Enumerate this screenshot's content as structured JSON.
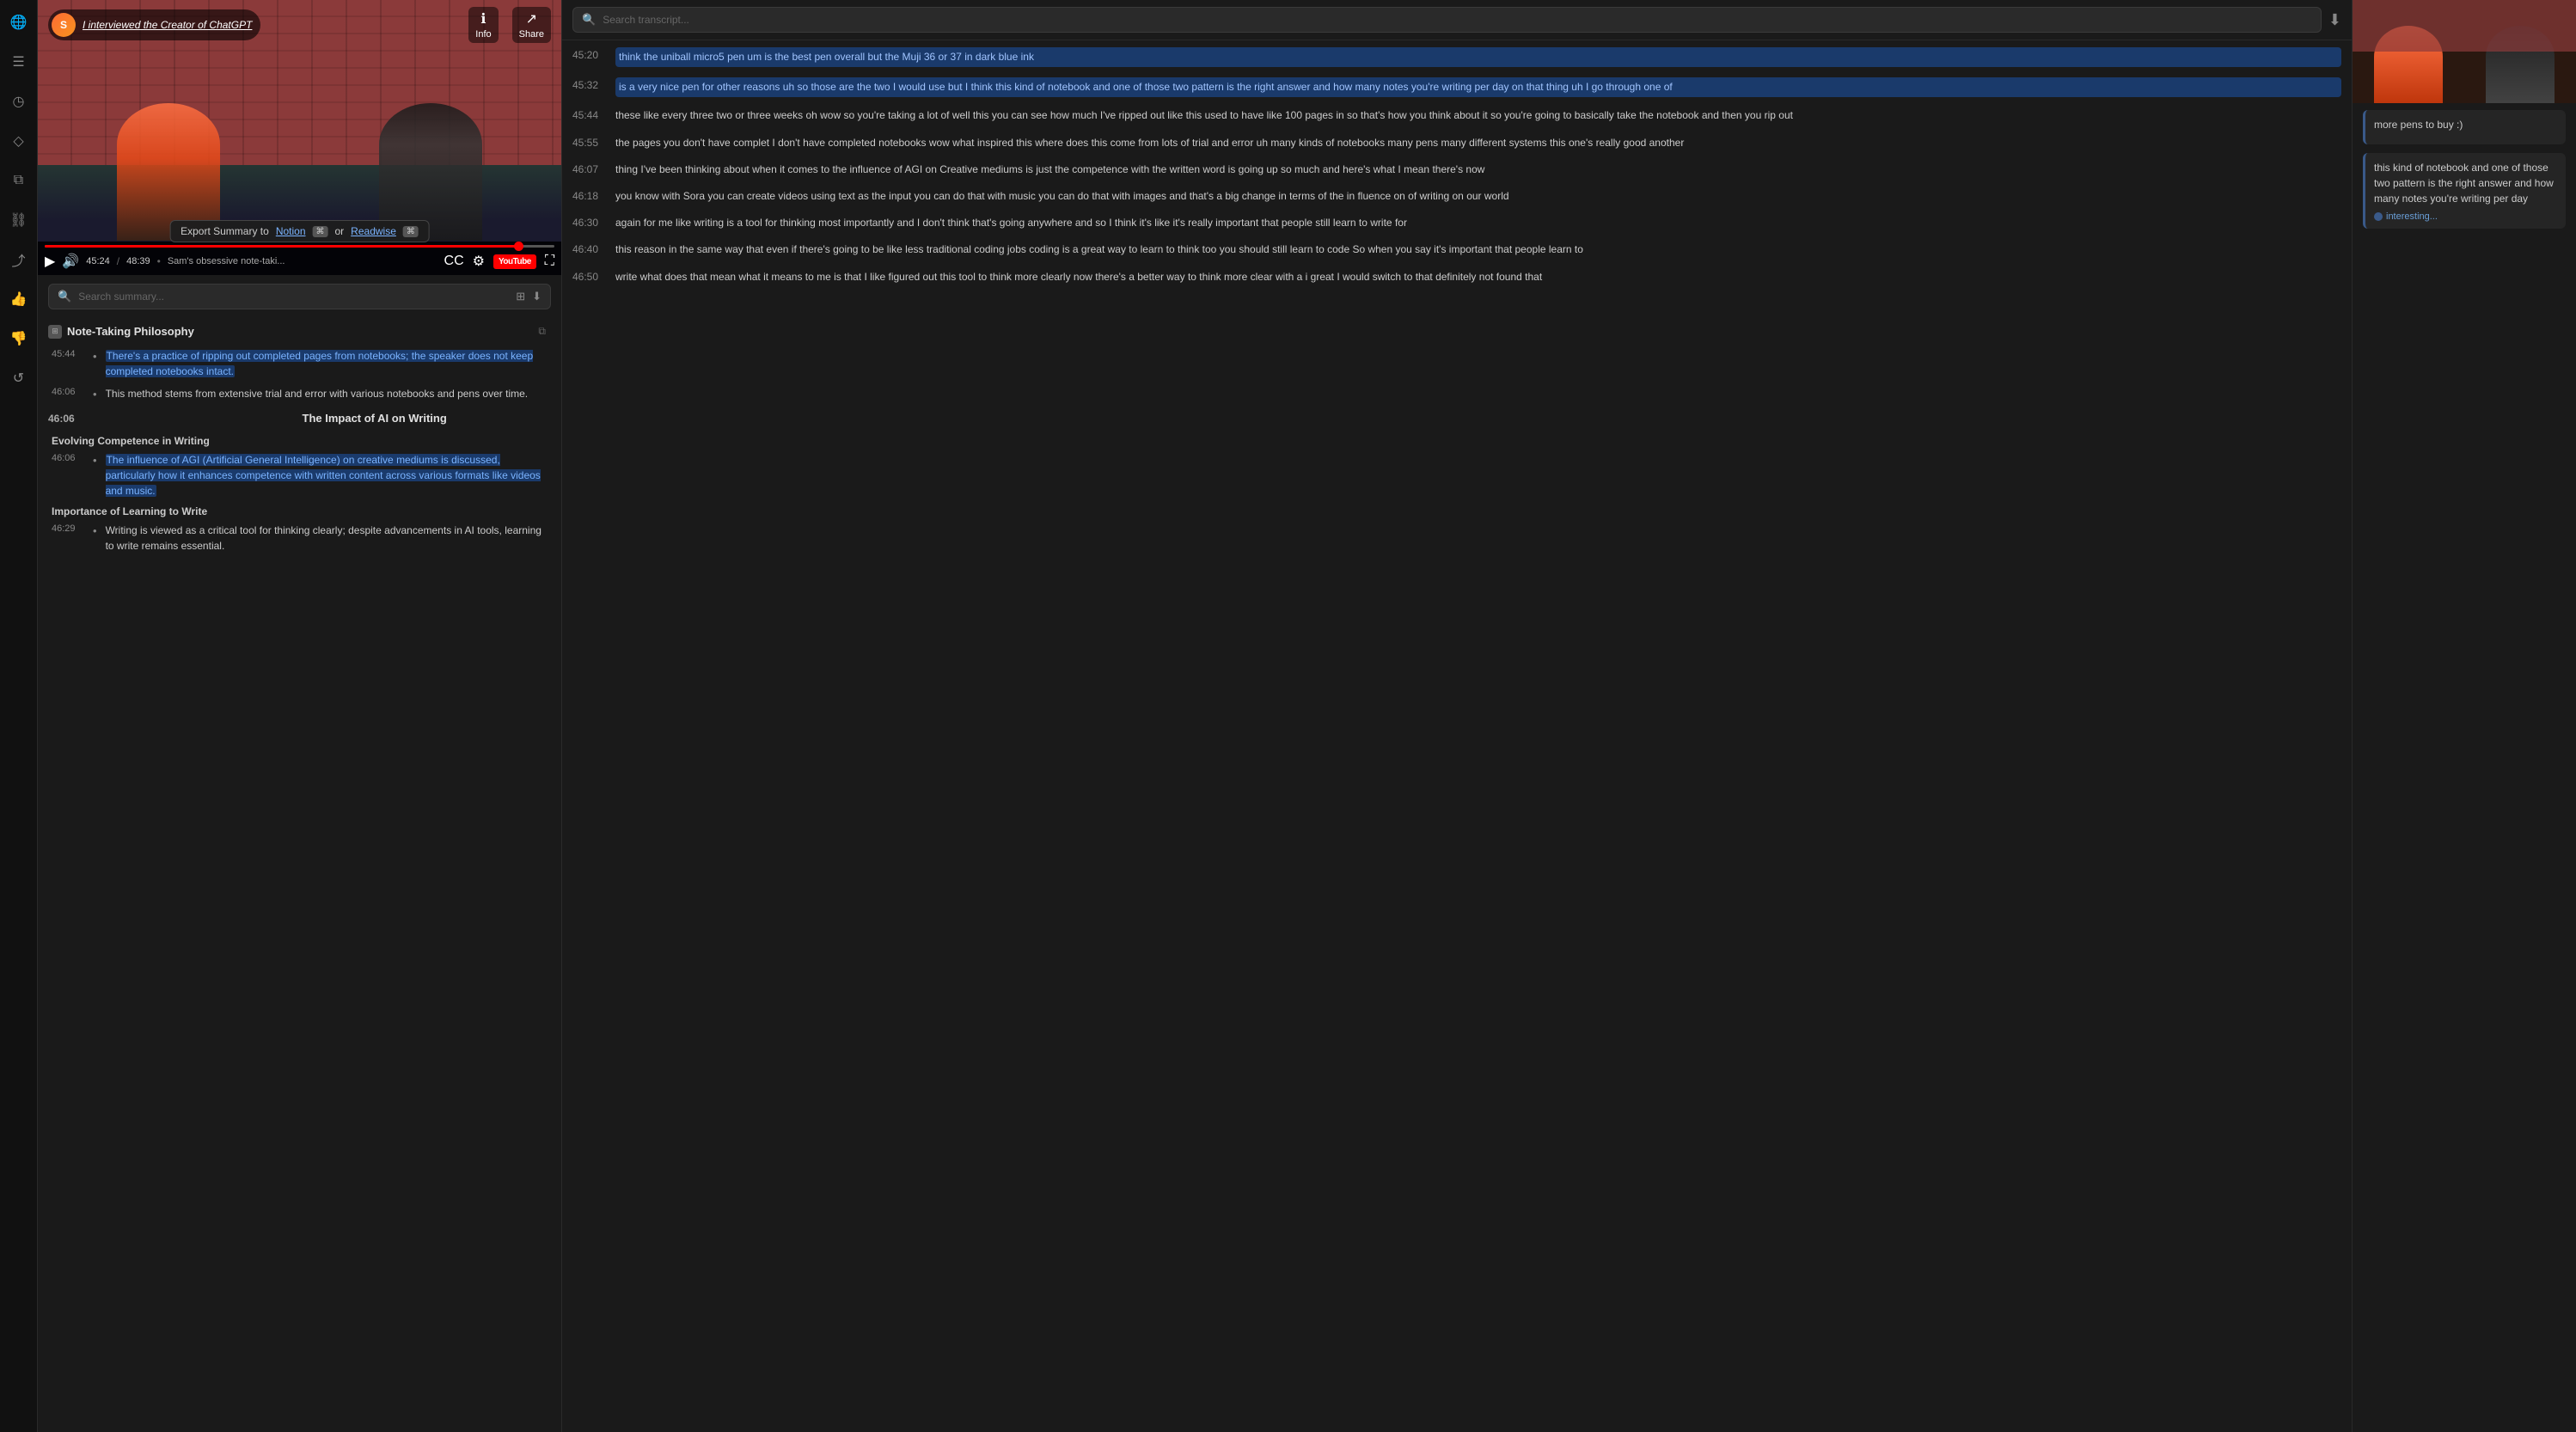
{
  "sidebar": {
    "icons": [
      {
        "name": "globe-icon",
        "symbol": "🌐"
      },
      {
        "name": "list-icon",
        "symbol": "☰"
      },
      {
        "name": "clock-icon",
        "symbol": "◷"
      },
      {
        "name": "bookmark-icon",
        "symbol": "◇"
      },
      {
        "name": "copy-icon",
        "symbol": "⧉"
      },
      {
        "name": "link-icon",
        "symbol": "⛓"
      },
      {
        "name": "share-icon",
        "symbol": "⤴"
      },
      {
        "name": "thumbsup-icon",
        "symbol": "👍"
      },
      {
        "name": "thumbsdown-icon",
        "symbol": "👎"
      },
      {
        "name": "refresh-icon",
        "symbol": "↺"
      }
    ]
  },
  "video": {
    "title": "I interviewed the Creator of ChatGPT",
    "channel": "S",
    "time_current": "45:24",
    "time_total": "48:39",
    "description": "Sam's obsessive note-taki...",
    "info_label": "Info",
    "share_label": "Share",
    "progress_percent": 94
  },
  "export_bar": {
    "text": "Export Summary to",
    "notion_label": "Notion",
    "or_label": "or",
    "readwise_label": "Readwise"
  },
  "summary": {
    "search_placeholder": "Search summary...",
    "sections": [
      {
        "id": "note-taking",
        "title": "Note-Taking Philosophy",
        "items": [
          {
            "time": "45:44",
            "text_parts": [
              {
                "text": "There's a practice of ripping out completed pages from notebooks; the speaker does not keep completed notebooks intact.",
                "highlighted": true
              }
            ]
          },
          {
            "time": "46:06",
            "text_parts": [
              {
                "text": "This method stems from extensive trial and error with various notebooks and pens over time.",
                "highlighted": false
              }
            ]
          }
        ]
      },
      {
        "id": "impact-ai",
        "title": "The Impact of AI on Writing",
        "items": []
      },
      {
        "id": "evolving-competence",
        "title": "Evolving Competence in Writing",
        "items": [
          {
            "time": "46:06",
            "text_parts": [
              {
                "text": "The influence of AGI (Artificial General Intelligence) on creative mediums is discussed, particularly how it enhances competence with written content across various formats like videos and music.",
                "highlighted": true
              }
            ]
          }
        ]
      },
      {
        "id": "importance-writing",
        "title": "Importance of Learning to Write",
        "items": [
          {
            "time": "46:29",
            "text_parts": [
              {
                "text": "Writing is viewed as a critical tool for thinking clearly; despite advancements in AI tools, learning to write remains essential.",
                "highlighted": false
              }
            ]
          }
        ]
      }
    ]
  },
  "transcript": {
    "search_placeholder": "Search transcript...",
    "entries": [
      {
        "time": "45:20",
        "text": "think the uniball micro5 pen um is the best pen overall but the Muji 36 or 37 in dark blue ink",
        "highlighted": true
      },
      {
        "time": "45:32",
        "text": "is a very nice pen for other reasons uh so those are the two I would use but I think this kind of notebook and one of those two pattern is the right answer and how many notes you're writing per day on that thing uh I go through one of",
        "highlighted": true
      },
      {
        "time": "45:44",
        "text": "these like every three two or three weeks oh wow so you're taking a lot of well this you can see how much I've ripped out like this used to have like 100 pages in so that's how you think about it so you're going to basically take the notebook and then you rip out",
        "highlighted": false
      },
      {
        "time": "45:55",
        "text": "the pages you don't have complet I don't have completed notebooks wow what inspired this where does this come from lots of trial and error uh many kinds of notebooks many pens many different systems this one's really good another",
        "highlighted": false
      },
      {
        "time": "46:07",
        "text": "thing I've been thinking about when it comes to the influence of AGI on Creative mediums is just the competence with the written word is going up so much and here's what I mean there's now",
        "highlighted": false
      },
      {
        "time": "46:18",
        "text": "you know with Sora you can create videos using text as the input you can do that with music you can do that with images and that's a big change in terms of the in fluence on of writing on our world",
        "highlighted": false
      },
      {
        "time": "46:30",
        "text": "again for me like writing is a tool for thinking most importantly and I don't think that's going anywhere and so I think it's like it's really important that people still learn to write for",
        "highlighted": false
      },
      {
        "time": "46:40",
        "text": "this reason in the same way that even if there's going to be like less traditional coding jobs coding is a great way to learn to think too you should still learn to code So when you say it's important that people learn to",
        "highlighted": false
      },
      {
        "time": "46:50",
        "text": "write what does that mean what it means to me is that I like figured out this tool to think more clearly now there's a better way to think more clear with a i great I would switch to that definitely not found that",
        "highlighted": false
      }
    ]
  },
  "annotations": {
    "notes": [
      {
        "id": "note1",
        "text": "more pens to buy :)",
        "tag": ""
      },
      {
        "id": "note2",
        "text": "this kind of notebook and one of those two pattern is the right answer and how many notes you're writing per day",
        "tag": "interesting..."
      }
    ]
  }
}
